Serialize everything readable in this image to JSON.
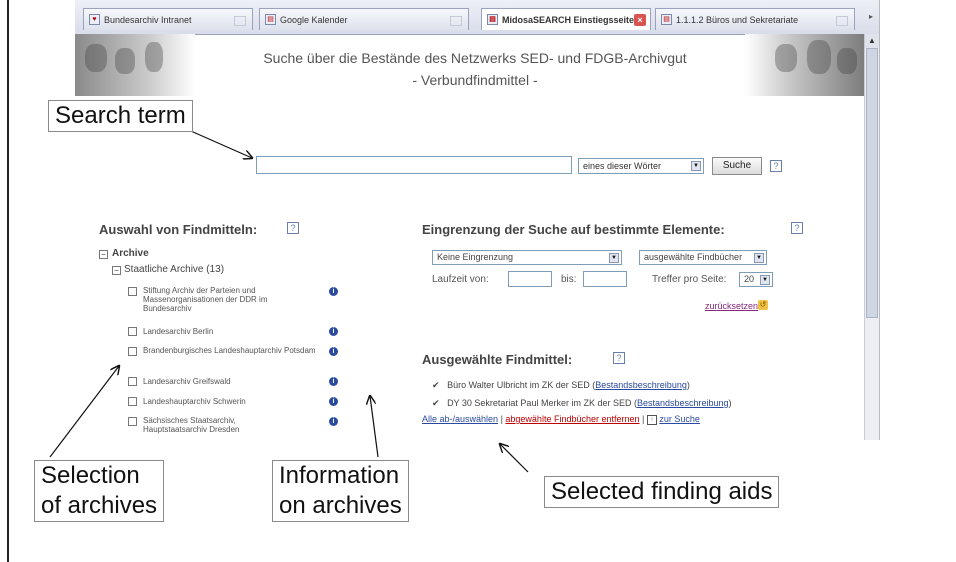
{
  "tabs": [
    {
      "label": "Bundesarchiv Intranet",
      "icon": "intranet-icon"
    },
    {
      "label": "Google Kalender",
      "icon": "calendar-icon"
    },
    {
      "label": "MidosaSEARCH Einstiegsseite",
      "icon": "page-icon",
      "active": true
    },
    {
      "label": "1.1.1.2 Büros und Sekretariate",
      "icon": "page-icon"
    }
  ],
  "header": {
    "title": "Suche über die Bestände des Netzwerks SED- und FDGB-Archivgut",
    "subtitle": "- Verbundfindmittel -"
  },
  "search": {
    "input_value": "",
    "mode_value": "eines dieser Wörter",
    "button_label": "Suche",
    "help_label": "?"
  },
  "left": {
    "section_title": "Auswahl von Findmitteln:",
    "tree_root_toggle": "−",
    "tree_root_label": "Archive",
    "tree_sub_toggle": "−",
    "tree_sub_label": "Staatliche Archive (13)",
    "archives": [
      {
        "label": "Stiftung Archiv der Parteien und Massenorganisationen der DDR im Bundesarchiv",
        "info": "i"
      },
      {
        "label": "Landesarchiv Berlin",
        "info": "i"
      },
      {
        "label": "Brandenburgisches Landeshauptarchiv Potsdam",
        "info": "i"
      },
      {
        "label": "Landesarchiv Greifswald",
        "info": "i"
      },
      {
        "label": "Landeshauptarchiv Schwerin",
        "info": "i"
      },
      {
        "label": "Sächsisches Staatsarchiv, Hauptstaatsarchiv Dresden",
        "info": "i"
      }
    ]
  },
  "right": {
    "filter_title": "Eingrenzung der Suche auf bestimmte Elemente:",
    "filter_value": "Keine Eingrenzung",
    "scope_value": "ausgewählte Findbücher",
    "laufzeit_label": "Laufzeit von:",
    "bis_label": "bis:",
    "laufzeit_from": "",
    "laufzeit_to": "",
    "treffer_label": "Treffer pro Seite:",
    "treffer_value": "20",
    "reset_link": "zurücksetzen",
    "selected_title": "Ausgewählte Findmittel:",
    "selected": [
      {
        "check": "✔",
        "text": "Büro Walter Ulbricht im ZK der SED (",
        "link": "Bestandsbeschreibung",
        "end": ")"
      },
      {
        "check": "✔",
        "text": "DY 30 Sekretariat Paul Merker im ZK der SED (",
        "link": "Bestandsbeschreibung",
        "end": ")"
      }
    ],
    "footer_link_all": "Alle ab-/auswählen",
    "footer_sep1": " | ",
    "footer_link_remove": "abgewählte Findbücher entfernen",
    "footer_sep2": " | ",
    "footer_link_search": "zur Suche",
    "footer_up_icon": "↑"
  },
  "callouts": {
    "search_term": "Search term",
    "selection": "Selection\nof archives",
    "information": "Information\non archives",
    "selected_aids": "Selected finding aids"
  }
}
